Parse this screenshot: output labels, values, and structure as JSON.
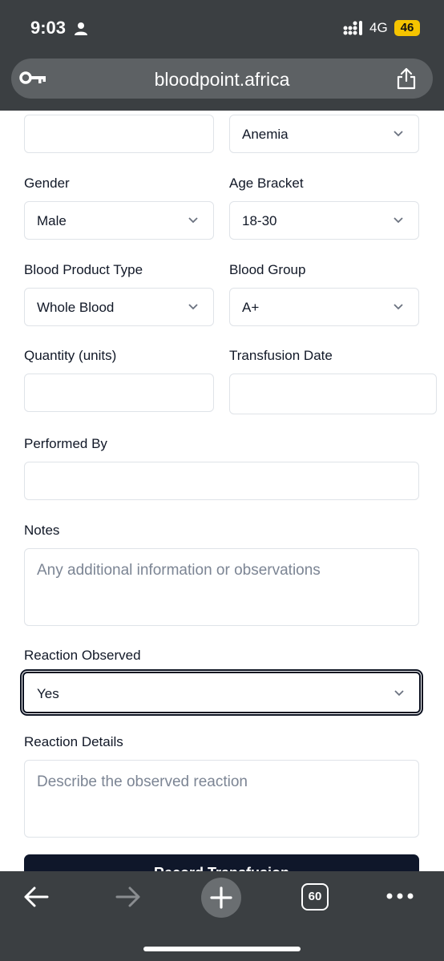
{
  "status_bar": {
    "time": "9:03",
    "network": "4G",
    "battery": "46"
  },
  "browser": {
    "url": "bloodpoint.africa",
    "tab_count": "60"
  },
  "form": {
    "row0": {
      "left_value": "",
      "right_value": "Anemia"
    },
    "gender": {
      "label": "Gender",
      "value": "Male"
    },
    "age_bracket": {
      "label": "Age Bracket",
      "value": "18-30"
    },
    "blood_product_type": {
      "label": "Blood Product Type",
      "value": "Whole Blood"
    },
    "blood_group": {
      "label": "Blood Group",
      "value": "A+"
    },
    "quantity": {
      "label": "Quantity (units)",
      "value": ""
    },
    "transfusion_date": {
      "label": "Transfusion Date",
      "value": ""
    },
    "performed_by": {
      "label": "Performed By",
      "value": ""
    },
    "notes": {
      "label": "Notes",
      "placeholder": "Any additional information or observations"
    },
    "reaction_observed": {
      "label": "Reaction Observed",
      "value": "Yes"
    },
    "reaction_details": {
      "label": "Reaction Details",
      "placeholder": "Describe the observed reaction"
    },
    "submit_label": "Record Transfusion"
  },
  "colors": {
    "chrome": "#3b3f42",
    "primary_button": "#0f172a",
    "battery": "#f5c400"
  }
}
